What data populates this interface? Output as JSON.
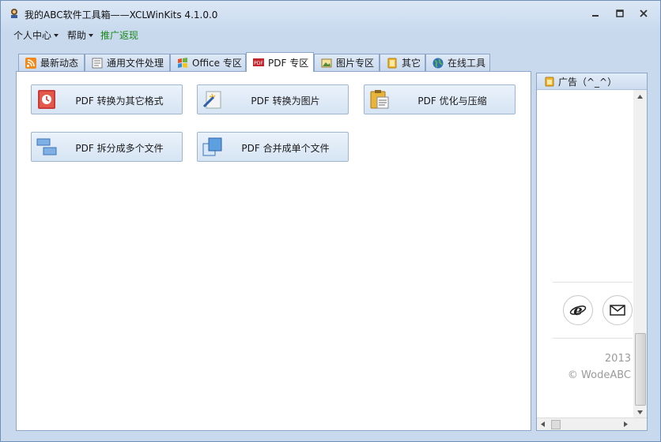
{
  "window": {
    "title": "我的ABC软件工具箱——XCLWinKits  4.1.0.0",
    "app_icon": "app-icon",
    "controls": [
      "minimize-icon",
      "maximize-icon",
      "close-icon"
    ]
  },
  "menubar": {
    "items": [
      {
        "label": "个人中心",
        "has_dropdown": true
      },
      {
        "label": "帮助",
        "has_dropdown": true
      },
      {
        "label": "推广返现",
        "has_dropdown": false,
        "color": "#1a8a1a"
      }
    ]
  },
  "tabs": [
    {
      "label": "最新动态",
      "icon": "rss-icon",
      "active": false
    },
    {
      "label": "通用文件处理",
      "icon": "document-icon",
      "active": false
    },
    {
      "label": "Office 专区",
      "icon": "windows-flag-icon",
      "active": false
    },
    {
      "label": "PDF 专区",
      "icon": "pdf-icon",
      "active": true
    },
    {
      "label": "图片专区",
      "icon": "picture-icon",
      "active": false
    },
    {
      "label": "其它",
      "icon": "folder-icon",
      "active": false
    },
    {
      "label": "在线工具",
      "icon": "globe-icon",
      "active": false
    }
  ],
  "tools": [
    {
      "label": "PDF 转换为其它格式",
      "icon": "convert-book-icon"
    },
    {
      "label": "PDF 转换为图片",
      "icon": "image-wand-icon"
    },
    {
      "label": "PDF 优化与压缩",
      "icon": "clipboard-icon"
    },
    {
      "label": "PDF 拆分成多个文件",
      "icon": "split-icon"
    },
    {
      "label": "PDF 合并成单个文件",
      "icon": "merge-icon"
    }
  ],
  "ad_panel": {
    "header": "广告（^_^）",
    "header_icon": "note-icon",
    "year": "2013",
    "copyright": "© WodeABC",
    "buttons": [
      {
        "name": "ie-browser-icon"
      },
      {
        "name": "mail-icon"
      }
    ]
  },
  "colors": {
    "accent": "#1a8a1a",
    "panel_border": "#8ba6c8",
    "button_fill": "#dfe9f6"
  }
}
